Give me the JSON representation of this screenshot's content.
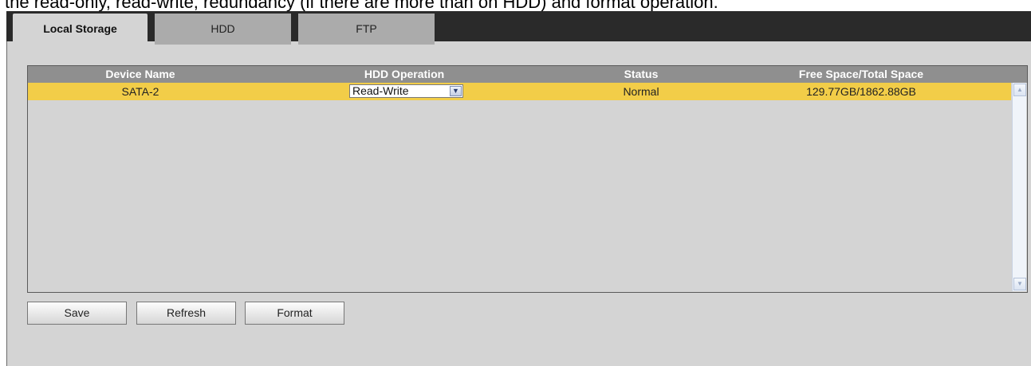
{
  "document": {
    "text": "the read-only, read-write, redundancy (if there are more than on HDD) and format operation."
  },
  "tabs": [
    {
      "label": "Local Storage",
      "active": true
    },
    {
      "label": "HDD",
      "active": false
    },
    {
      "label": "FTP",
      "active": false
    }
  ],
  "table": {
    "columns": [
      "Device Name",
      "HDD Operation",
      "Status",
      "Free Space/Total Space"
    ],
    "rows": [
      {
        "device_name": "SATA-2",
        "hdd_operation": "Read-Write",
        "status": "Normal",
        "space": "129.77GB/1862.88GB",
        "selected": true
      }
    ]
  },
  "buttons": {
    "save": "Save",
    "refresh": "Refresh",
    "format": "Format"
  },
  "colors": {
    "tab_bar": "#2a2a2a",
    "panel": "#d4d4d4",
    "header": "#8f8f8f",
    "selected_row": "#f2cd48"
  },
  "icons": {
    "dropdown": "chevron-down-icon",
    "scroll_up": "scroll-up-icon",
    "scroll_down": "scroll-down-icon"
  }
}
